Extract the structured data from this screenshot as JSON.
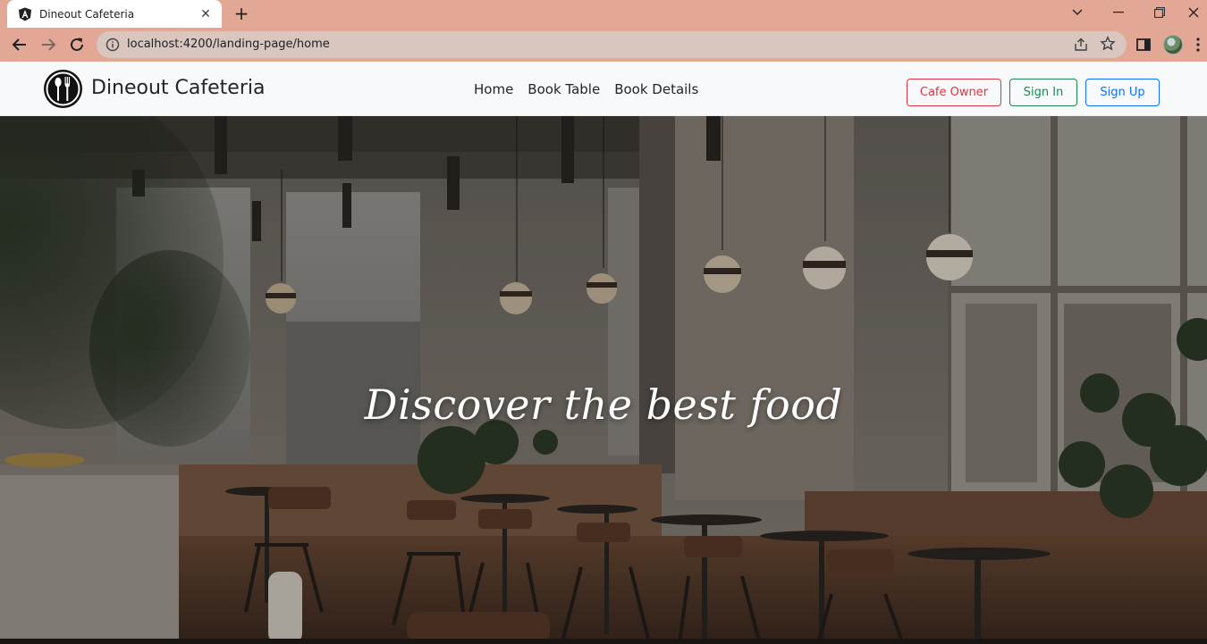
{
  "browser": {
    "tab_title": "Dineout Cafeteria",
    "url": "localhost:4200/landing-page/home"
  },
  "navbar": {
    "brand": "Dineout Cafeteria",
    "links": [
      "Home",
      "Book Table",
      "Book Details"
    ],
    "buttons": {
      "cafe_owner": "Cafe Owner",
      "sign_in": "Sign In",
      "sign_up": "Sign Up"
    }
  },
  "hero": {
    "headline": "Discover the best food"
  },
  "colors": {
    "chrome": "#e3a796",
    "owner_button": "#dc3545",
    "signin_button": "#198754",
    "signup_button": "#0d6efd"
  },
  "icons": [
    "angular-icon",
    "close-icon",
    "plus-icon",
    "back-icon",
    "forward-icon",
    "reload-icon",
    "info-icon",
    "share-icon",
    "star-icon",
    "sidebar-icon",
    "menu-icon",
    "dining-logo-icon"
  ]
}
